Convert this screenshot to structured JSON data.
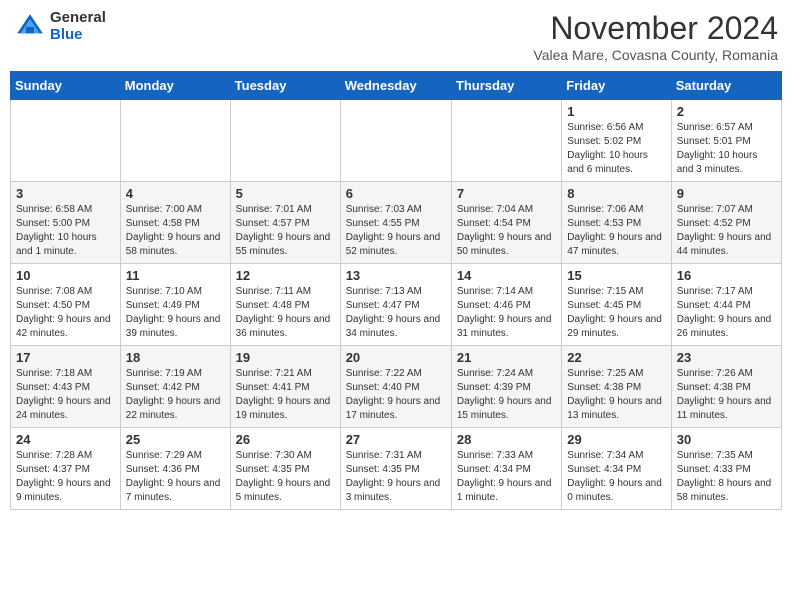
{
  "header": {
    "logo_general": "General",
    "logo_blue": "Blue",
    "month_title": "November 2024",
    "subtitle": "Valea Mare, Covasna County, Romania"
  },
  "weekdays": [
    "Sunday",
    "Monday",
    "Tuesday",
    "Wednesday",
    "Thursday",
    "Friday",
    "Saturday"
  ],
  "weeks": [
    [
      {
        "day": "",
        "info": ""
      },
      {
        "day": "",
        "info": ""
      },
      {
        "day": "",
        "info": ""
      },
      {
        "day": "",
        "info": ""
      },
      {
        "day": "",
        "info": ""
      },
      {
        "day": "1",
        "info": "Sunrise: 6:56 AM\nSunset: 5:02 PM\nDaylight: 10 hours and 6 minutes."
      },
      {
        "day": "2",
        "info": "Sunrise: 6:57 AM\nSunset: 5:01 PM\nDaylight: 10 hours and 3 minutes."
      }
    ],
    [
      {
        "day": "3",
        "info": "Sunrise: 6:58 AM\nSunset: 5:00 PM\nDaylight: 10 hours and 1 minute."
      },
      {
        "day": "4",
        "info": "Sunrise: 7:00 AM\nSunset: 4:58 PM\nDaylight: 9 hours and 58 minutes."
      },
      {
        "day": "5",
        "info": "Sunrise: 7:01 AM\nSunset: 4:57 PM\nDaylight: 9 hours and 55 minutes."
      },
      {
        "day": "6",
        "info": "Sunrise: 7:03 AM\nSunset: 4:55 PM\nDaylight: 9 hours and 52 minutes."
      },
      {
        "day": "7",
        "info": "Sunrise: 7:04 AM\nSunset: 4:54 PM\nDaylight: 9 hours and 50 minutes."
      },
      {
        "day": "8",
        "info": "Sunrise: 7:06 AM\nSunset: 4:53 PM\nDaylight: 9 hours and 47 minutes."
      },
      {
        "day": "9",
        "info": "Sunrise: 7:07 AM\nSunset: 4:52 PM\nDaylight: 9 hours and 44 minutes."
      }
    ],
    [
      {
        "day": "10",
        "info": "Sunrise: 7:08 AM\nSunset: 4:50 PM\nDaylight: 9 hours and 42 minutes."
      },
      {
        "day": "11",
        "info": "Sunrise: 7:10 AM\nSunset: 4:49 PM\nDaylight: 9 hours and 39 minutes."
      },
      {
        "day": "12",
        "info": "Sunrise: 7:11 AM\nSunset: 4:48 PM\nDaylight: 9 hours and 36 minutes."
      },
      {
        "day": "13",
        "info": "Sunrise: 7:13 AM\nSunset: 4:47 PM\nDaylight: 9 hours and 34 minutes."
      },
      {
        "day": "14",
        "info": "Sunrise: 7:14 AM\nSunset: 4:46 PM\nDaylight: 9 hours and 31 minutes."
      },
      {
        "day": "15",
        "info": "Sunrise: 7:15 AM\nSunset: 4:45 PM\nDaylight: 9 hours and 29 minutes."
      },
      {
        "day": "16",
        "info": "Sunrise: 7:17 AM\nSunset: 4:44 PM\nDaylight: 9 hours and 26 minutes."
      }
    ],
    [
      {
        "day": "17",
        "info": "Sunrise: 7:18 AM\nSunset: 4:43 PM\nDaylight: 9 hours and 24 minutes."
      },
      {
        "day": "18",
        "info": "Sunrise: 7:19 AM\nSunset: 4:42 PM\nDaylight: 9 hours and 22 minutes."
      },
      {
        "day": "19",
        "info": "Sunrise: 7:21 AM\nSunset: 4:41 PM\nDaylight: 9 hours and 19 minutes."
      },
      {
        "day": "20",
        "info": "Sunrise: 7:22 AM\nSunset: 4:40 PM\nDaylight: 9 hours and 17 minutes."
      },
      {
        "day": "21",
        "info": "Sunrise: 7:24 AM\nSunset: 4:39 PM\nDaylight: 9 hours and 15 minutes."
      },
      {
        "day": "22",
        "info": "Sunrise: 7:25 AM\nSunset: 4:38 PM\nDaylight: 9 hours and 13 minutes."
      },
      {
        "day": "23",
        "info": "Sunrise: 7:26 AM\nSunset: 4:38 PM\nDaylight: 9 hours and 11 minutes."
      }
    ],
    [
      {
        "day": "24",
        "info": "Sunrise: 7:28 AM\nSunset: 4:37 PM\nDaylight: 9 hours and 9 minutes."
      },
      {
        "day": "25",
        "info": "Sunrise: 7:29 AM\nSunset: 4:36 PM\nDaylight: 9 hours and 7 minutes."
      },
      {
        "day": "26",
        "info": "Sunrise: 7:30 AM\nSunset: 4:35 PM\nDaylight: 9 hours and 5 minutes."
      },
      {
        "day": "27",
        "info": "Sunrise: 7:31 AM\nSunset: 4:35 PM\nDaylight: 9 hours and 3 minutes."
      },
      {
        "day": "28",
        "info": "Sunrise: 7:33 AM\nSunset: 4:34 PM\nDaylight: 9 hours and 1 minute."
      },
      {
        "day": "29",
        "info": "Sunrise: 7:34 AM\nSunset: 4:34 PM\nDaylight: 9 hours and 0 minutes."
      },
      {
        "day": "30",
        "info": "Sunrise: 7:35 AM\nSunset: 4:33 PM\nDaylight: 8 hours and 58 minutes."
      }
    ]
  ]
}
